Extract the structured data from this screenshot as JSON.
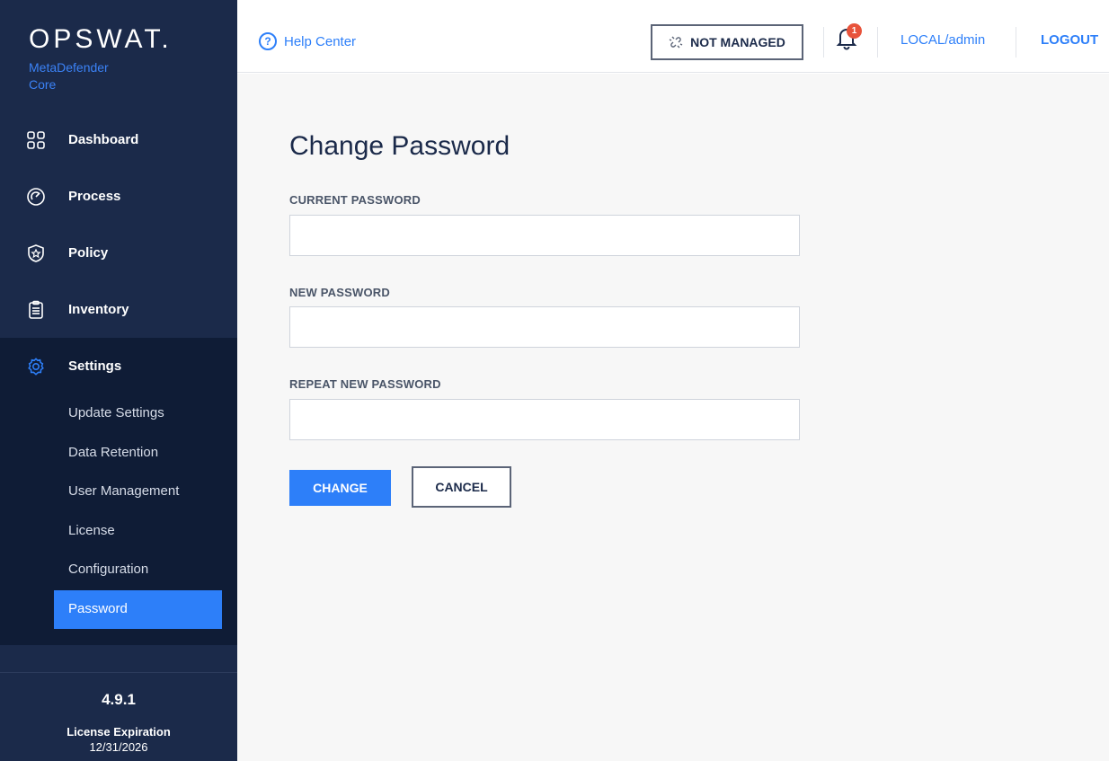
{
  "brand": {
    "logo": "OPSWAT.",
    "product": "MetaDefender",
    "product_suffix": "Core"
  },
  "sidebar": {
    "items": [
      {
        "label": "Dashboard",
        "icon": "dashboard-grid-icon"
      },
      {
        "label": "Process",
        "icon": "process-gauge-icon"
      },
      {
        "label": "Policy",
        "icon": "policy-shield-icon"
      },
      {
        "label": "Inventory",
        "icon": "inventory-clipboard-icon"
      },
      {
        "label": "Settings",
        "icon": "settings-gear-icon"
      }
    ],
    "settings_subitems": [
      {
        "label": "Update Settings"
      },
      {
        "label": "Data Retention"
      },
      {
        "label": "User Management"
      },
      {
        "label": "License"
      },
      {
        "label": "Configuration"
      },
      {
        "label": "Password",
        "active": true
      }
    ],
    "footer": {
      "version": "4.9.1",
      "license_label": "License Expiration",
      "license_date": "12/31/2026"
    }
  },
  "topbar": {
    "help": "Help Center",
    "managed_status": "NOT MANAGED",
    "notification_count": "1",
    "user": "LOCAL/admin",
    "logout": "LOGOUT"
  },
  "form": {
    "title": "Change Password",
    "current_password_label": "CURRENT PASSWORD",
    "current_password_value": "",
    "new_password_label": "NEW PASSWORD",
    "new_password_value": "",
    "repeat_password_label": "REPEAT NEW PASSWORD",
    "repeat_password_value": "",
    "submit_label": "CHANGE",
    "cancel_label": "CANCEL"
  },
  "colors": {
    "sidebar_bg": "#1b2a4a",
    "accent": "#2d7ff9",
    "badge": "#e8533b"
  }
}
